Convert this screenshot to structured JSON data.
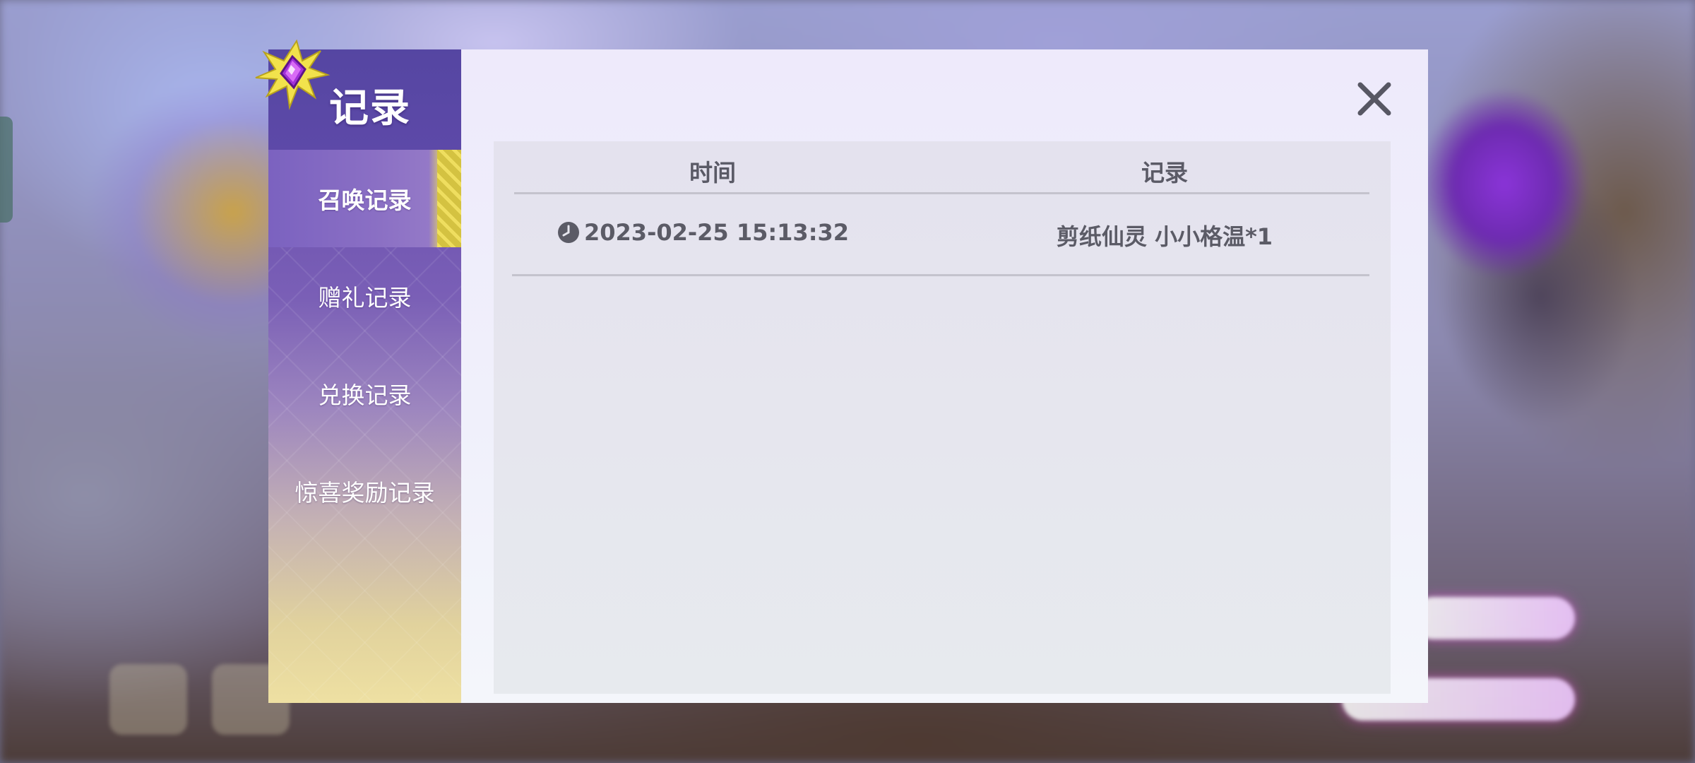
{
  "dialog": {
    "title": "记录",
    "close_icon": "close-icon"
  },
  "sidebar": {
    "items": [
      {
        "label": "召唤记录",
        "active": true
      },
      {
        "label": "赠礼记录",
        "active": false
      },
      {
        "label": "兑换记录",
        "active": false
      },
      {
        "label": "惊喜奖励记录",
        "active": false
      }
    ]
  },
  "table": {
    "columns": [
      "时间",
      "记录"
    ],
    "rows": [
      {
        "time": "2023-02-25 15:13:32",
        "record": "剪纸仙灵 小小格温*1"
      }
    ]
  },
  "colors": {
    "sidebar_top": "#5546a2",
    "sidebar_bottom": "#eee0a2",
    "active_accent": "#efdf55",
    "text_dark": "#5a5a66"
  }
}
